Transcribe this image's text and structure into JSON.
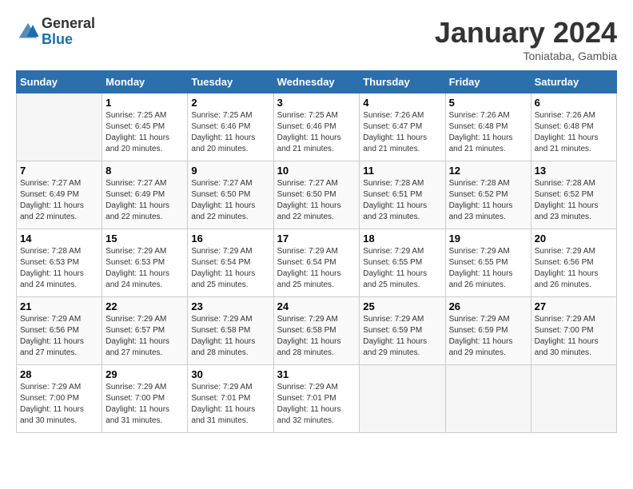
{
  "header": {
    "logo_general": "General",
    "logo_blue": "Blue",
    "month_title": "January 2024",
    "location": "Toniataba, Gambia"
  },
  "calendar": {
    "days_of_week": [
      "Sunday",
      "Monday",
      "Tuesday",
      "Wednesday",
      "Thursday",
      "Friday",
      "Saturday"
    ],
    "weeks": [
      [
        {
          "num": "",
          "info": ""
        },
        {
          "num": "1",
          "info": "Sunrise: 7:25 AM\nSunset: 6:45 PM\nDaylight: 11 hours\nand 20 minutes."
        },
        {
          "num": "2",
          "info": "Sunrise: 7:25 AM\nSunset: 6:46 PM\nDaylight: 11 hours\nand 20 minutes."
        },
        {
          "num": "3",
          "info": "Sunrise: 7:25 AM\nSunset: 6:46 PM\nDaylight: 11 hours\nand 21 minutes."
        },
        {
          "num": "4",
          "info": "Sunrise: 7:26 AM\nSunset: 6:47 PM\nDaylight: 11 hours\nand 21 minutes."
        },
        {
          "num": "5",
          "info": "Sunrise: 7:26 AM\nSunset: 6:48 PM\nDaylight: 11 hours\nand 21 minutes."
        },
        {
          "num": "6",
          "info": "Sunrise: 7:26 AM\nSunset: 6:48 PM\nDaylight: 11 hours\nand 21 minutes."
        }
      ],
      [
        {
          "num": "7",
          "info": "Sunrise: 7:27 AM\nSunset: 6:49 PM\nDaylight: 11 hours\nand 22 minutes."
        },
        {
          "num": "8",
          "info": "Sunrise: 7:27 AM\nSunset: 6:49 PM\nDaylight: 11 hours\nand 22 minutes."
        },
        {
          "num": "9",
          "info": "Sunrise: 7:27 AM\nSunset: 6:50 PM\nDaylight: 11 hours\nand 22 minutes."
        },
        {
          "num": "10",
          "info": "Sunrise: 7:27 AM\nSunset: 6:50 PM\nDaylight: 11 hours\nand 22 minutes."
        },
        {
          "num": "11",
          "info": "Sunrise: 7:28 AM\nSunset: 6:51 PM\nDaylight: 11 hours\nand 23 minutes."
        },
        {
          "num": "12",
          "info": "Sunrise: 7:28 AM\nSunset: 6:52 PM\nDaylight: 11 hours\nand 23 minutes."
        },
        {
          "num": "13",
          "info": "Sunrise: 7:28 AM\nSunset: 6:52 PM\nDaylight: 11 hours\nand 23 minutes."
        }
      ],
      [
        {
          "num": "14",
          "info": "Sunrise: 7:28 AM\nSunset: 6:53 PM\nDaylight: 11 hours\nand 24 minutes."
        },
        {
          "num": "15",
          "info": "Sunrise: 7:29 AM\nSunset: 6:53 PM\nDaylight: 11 hours\nand 24 minutes."
        },
        {
          "num": "16",
          "info": "Sunrise: 7:29 AM\nSunset: 6:54 PM\nDaylight: 11 hours\nand 25 minutes."
        },
        {
          "num": "17",
          "info": "Sunrise: 7:29 AM\nSunset: 6:54 PM\nDaylight: 11 hours\nand 25 minutes."
        },
        {
          "num": "18",
          "info": "Sunrise: 7:29 AM\nSunset: 6:55 PM\nDaylight: 11 hours\nand 25 minutes."
        },
        {
          "num": "19",
          "info": "Sunrise: 7:29 AM\nSunset: 6:55 PM\nDaylight: 11 hours\nand 26 minutes."
        },
        {
          "num": "20",
          "info": "Sunrise: 7:29 AM\nSunset: 6:56 PM\nDaylight: 11 hours\nand 26 minutes."
        }
      ],
      [
        {
          "num": "21",
          "info": "Sunrise: 7:29 AM\nSunset: 6:56 PM\nDaylight: 11 hours\nand 27 minutes."
        },
        {
          "num": "22",
          "info": "Sunrise: 7:29 AM\nSunset: 6:57 PM\nDaylight: 11 hours\nand 27 minutes."
        },
        {
          "num": "23",
          "info": "Sunrise: 7:29 AM\nSunset: 6:58 PM\nDaylight: 11 hours\nand 28 minutes."
        },
        {
          "num": "24",
          "info": "Sunrise: 7:29 AM\nSunset: 6:58 PM\nDaylight: 11 hours\nand 28 minutes."
        },
        {
          "num": "25",
          "info": "Sunrise: 7:29 AM\nSunset: 6:59 PM\nDaylight: 11 hours\nand 29 minutes."
        },
        {
          "num": "26",
          "info": "Sunrise: 7:29 AM\nSunset: 6:59 PM\nDaylight: 11 hours\nand 29 minutes."
        },
        {
          "num": "27",
          "info": "Sunrise: 7:29 AM\nSunset: 7:00 PM\nDaylight: 11 hours\nand 30 minutes."
        }
      ],
      [
        {
          "num": "28",
          "info": "Sunrise: 7:29 AM\nSunset: 7:00 PM\nDaylight: 11 hours\nand 30 minutes."
        },
        {
          "num": "29",
          "info": "Sunrise: 7:29 AM\nSunset: 7:00 PM\nDaylight: 11 hours\nand 31 minutes."
        },
        {
          "num": "30",
          "info": "Sunrise: 7:29 AM\nSunset: 7:01 PM\nDaylight: 11 hours\nand 31 minutes."
        },
        {
          "num": "31",
          "info": "Sunrise: 7:29 AM\nSunset: 7:01 PM\nDaylight: 11 hours\nand 32 minutes."
        },
        {
          "num": "",
          "info": ""
        },
        {
          "num": "",
          "info": ""
        },
        {
          "num": "",
          "info": ""
        }
      ]
    ]
  }
}
